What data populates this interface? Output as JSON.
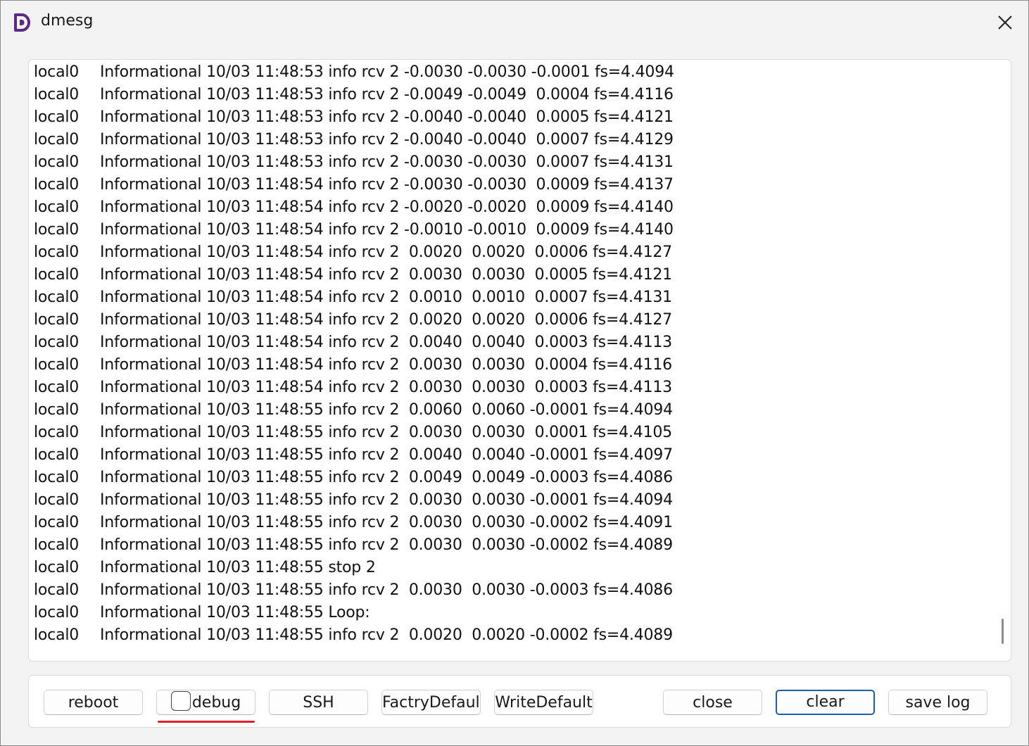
{
  "window": {
    "title": "dmesg",
    "icon": "app-d-logo-icon",
    "close_icon": "close-icon",
    "accent": "#5b2a86"
  },
  "log": {
    "lines": [
      {
        "source": "local0",
        "message": "Informational 10/03 11:48:53 info rcv 2 -0.0030 -0.0030 -0.0001 fs=4.4094"
      },
      {
        "source": "local0",
        "message": "Informational 10/03 11:48:53 info rcv 2 -0.0049 -0.0049  0.0004 fs=4.4116"
      },
      {
        "source": "local0",
        "message": "Informational 10/03 11:48:53 info rcv 2 -0.0040 -0.0040  0.0005 fs=4.4121"
      },
      {
        "source": "local0",
        "message": "Informational 10/03 11:48:53 info rcv 2 -0.0040 -0.0040  0.0007 fs=4.4129"
      },
      {
        "source": "local0",
        "message": "Informational 10/03 11:48:53 info rcv 2 -0.0030 -0.0030  0.0007 fs=4.4131"
      },
      {
        "source": "local0",
        "message": "Informational 10/03 11:48:54 info rcv 2 -0.0030 -0.0030  0.0009 fs=4.4137"
      },
      {
        "source": "local0",
        "message": "Informational 10/03 11:48:54 info rcv 2 -0.0020 -0.0020  0.0009 fs=4.4140"
      },
      {
        "source": "local0",
        "message": "Informational 10/03 11:48:54 info rcv 2 -0.0010 -0.0010  0.0009 fs=4.4140"
      },
      {
        "source": "local0",
        "message": "Informational 10/03 11:48:54 info rcv 2  0.0020  0.0020  0.0006 fs=4.4127"
      },
      {
        "source": "local0",
        "message": "Informational 10/03 11:48:54 info rcv 2  0.0030  0.0030  0.0005 fs=4.4121"
      },
      {
        "source": "local0",
        "message": "Informational 10/03 11:48:54 info rcv 2  0.0010  0.0010  0.0007 fs=4.4131"
      },
      {
        "source": "local0",
        "message": "Informational 10/03 11:48:54 info rcv 2  0.0020  0.0020  0.0006 fs=4.4127"
      },
      {
        "source": "local0",
        "message": "Informational 10/03 11:48:54 info rcv 2  0.0040  0.0040  0.0003 fs=4.4113"
      },
      {
        "source": "local0",
        "message": "Informational 10/03 11:48:54 info rcv 2  0.0030  0.0030  0.0004 fs=4.4116"
      },
      {
        "source": "local0",
        "message": "Informational 10/03 11:48:54 info rcv 2  0.0030  0.0030  0.0003 fs=4.4113"
      },
      {
        "source": "local0",
        "message": "Informational 10/03 11:48:55 info rcv 2  0.0060  0.0060 -0.0001 fs=4.4094"
      },
      {
        "source": "local0",
        "message": "Informational 10/03 11:48:55 info rcv 2  0.0030  0.0030  0.0001 fs=4.4105"
      },
      {
        "source": "local0",
        "message": "Informational 10/03 11:48:55 info rcv 2  0.0040  0.0040 -0.0001 fs=4.4097"
      },
      {
        "source": "local0",
        "message": "Informational 10/03 11:48:55 info rcv 2  0.0049  0.0049 -0.0003 fs=4.4086"
      },
      {
        "source": "local0",
        "message": "Informational 10/03 11:48:55 info rcv 2  0.0030  0.0030 -0.0001 fs=4.4094"
      },
      {
        "source": "local0",
        "message": "Informational 10/03 11:48:55 info rcv 2  0.0030  0.0030 -0.0002 fs=4.4091"
      },
      {
        "source": "local0",
        "message": "Informational 10/03 11:48:55 info rcv 2  0.0030  0.0030 -0.0002 fs=4.4089"
      },
      {
        "source": "local0",
        "message": "Informational 10/03 11:48:55 stop 2"
      },
      {
        "source": "local0",
        "message": "Informational 10/03 11:48:55 info rcv 2  0.0030  0.0030 -0.0003 fs=4.4086"
      },
      {
        "source": "local0",
        "message": "Informational 10/03 11:48:55 Loop:"
      },
      {
        "source": "local0",
        "message": "Informational 10/03 11:48:55 info rcv 2  0.0020  0.0020 -0.0002 fs=4.4089"
      }
    ]
  },
  "buttons": {
    "reboot": "reboot",
    "debug": "debug",
    "debug_checked": false,
    "ssh": "SSH",
    "factory_default": "FactryDefault",
    "write_default": "WriteDefault",
    "close": "close",
    "clear": "clear",
    "save_log": "save log"
  },
  "annotation": {
    "underline_color": "#e0202a"
  }
}
